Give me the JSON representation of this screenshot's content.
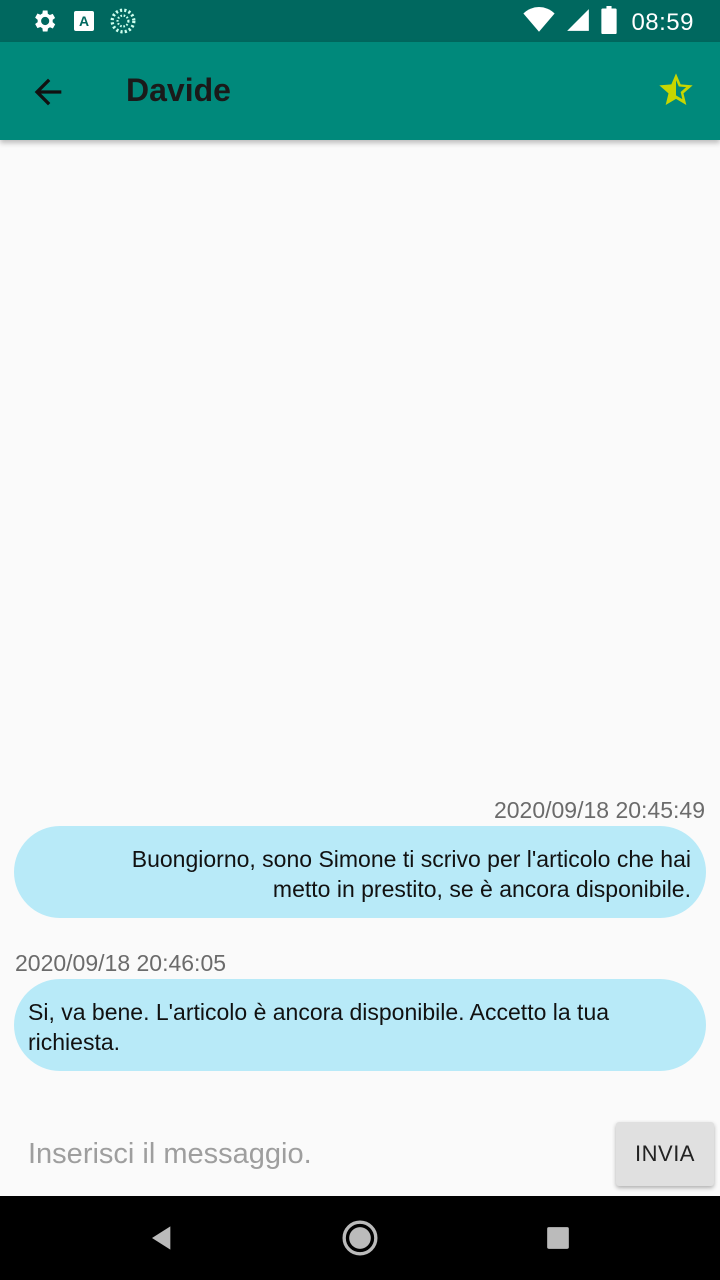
{
  "status_bar": {
    "time": "08:59",
    "icons": [
      "settings-icon",
      "a-box-icon",
      "sync-icon",
      "wifi-icon",
      "signal-icon",
      "battery-icon"
    ]
  },
  "app_bar": {
    "title": "Davide",
    "back_icon": "arrow-back-icon",
    "favorite_icon": "star-half-icon",
    "accent": "#00897b",
    "star_color": "#c8d600"
  },
  "messages": [
    {
      "direction": "sent",
      "timestamp": "2020/09/18 20:45:49",
      "text": "Buongiorno, sono Simone ti scrivo per l'articolo che hai metto in prestito, se è ancora disponibile."
    },
    {
      "direction": "received",
      "timestamp": "2020/09/18 20:46:05",
      "text": "Si, va bene. L'articolo è ancora disponibile. Accetto la tua richiesta."
    }
  ],
  "composer": {
    "placeholder": "Inserisci il messaggio.",
    "value": "",
    "send_label": "INVIA"
  },
  "nav_bar": {
    "icons": [
      "back-triangle-icon",
      "home-circle-icon",
      "recents-square-icon"
    ]
  }
}
